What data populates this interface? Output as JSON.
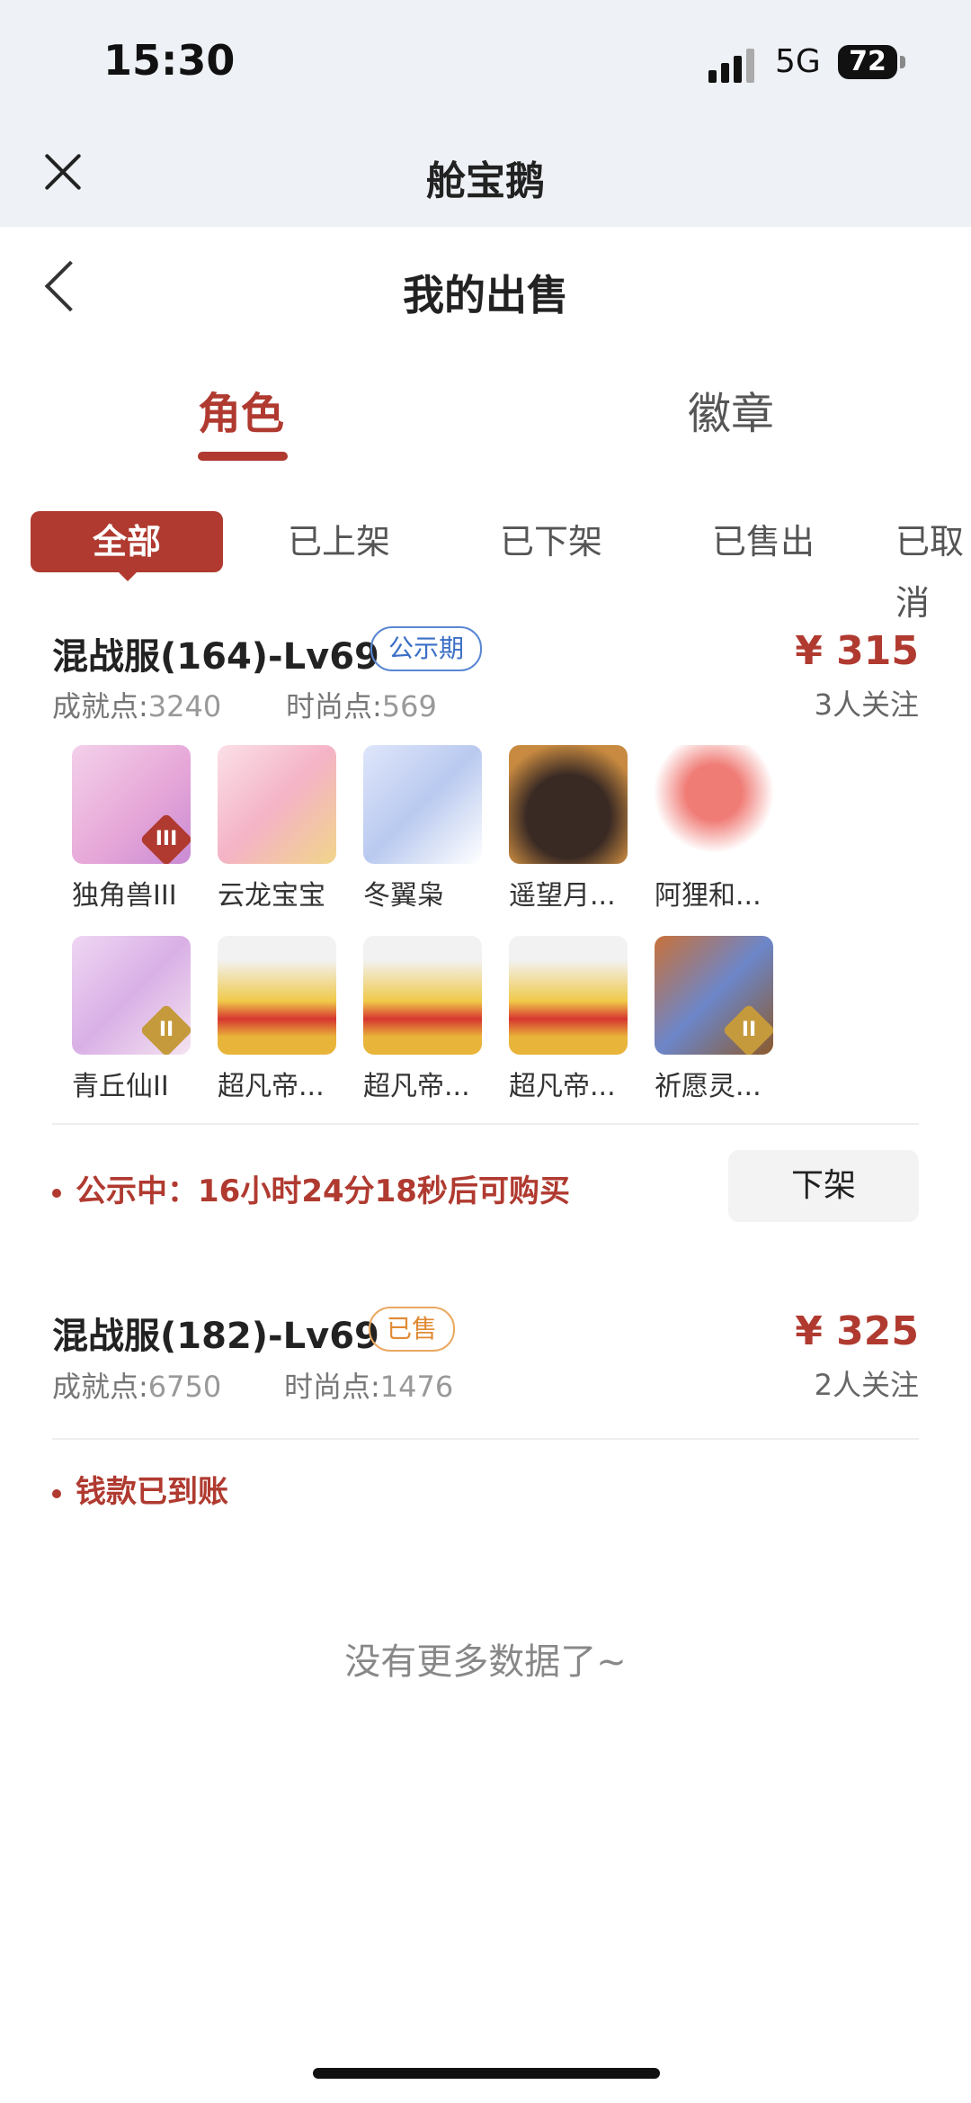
{
  "status_bar": {
    "time": "15:30",
    "network": "5G",
    "battery": "72"
  },
  "app": {
    "title": "舱宝鹅"
  },
  "page": {
    "title": "我的出售"
  },
  "tabs": [
    {
      "label": "角色",
      "active": true
    },
    {
      "label": "徽章",
      "active": false
    }
  ],
  "filters": [
    {
      "label": "全部",
      "active": true
    },
    {
      "label": "已上架",
      "active": false
    },
    {
      "label": "已下架",
      "active": false
    },
    {
      "label": "已售出",
      "active": false
    },
    {
      "label": "已取消",
      "active": false
    }
  ],
  "listings": [
    {
      "title": "混战服(164)-Lv69",
      "tag": "公示期",
      "price": "¥ 315",
      "achievement_label": "成就点:",
      "achievement": "3240",
      "fashion_label": "时尚点:",
      "fashion": "569",
      "followers": "3人关注",
      "items": [
        {
          "label": "独角兽III",
          "icon": "unicorn-icon",
          "badge": "III"
        },
        {
          "label": "云龙宝宝",
          "icon": "cloud-dragon-icon"
        },
        {
          "label": "冬翼枭",
          "icon": "winter-owl-icon"
        },
        {
          "label": "遥望月...",
          "icon": "moon-pig-icon"
        },
        {
          "label": "阿狸和...",
          "icon": "ali-fox-icon"
        },
        {
          "label": "青丘仙II",
          "icon": "fox-fairy-icon",
          "badge": "II"
        },
        {
          "label": "超凡帝...",
          "icon": "golden-armor-icon"
        },
        {
          "label": "超凡帝...",
          "icon": "golden-armor-icon"
        },
        {
          "label": "超凡帝...",
          "icon": "golden-armor-icon"
        },
        {
          "label": "祈愿灵...",
          "icon": "wish-bird-icon",
          "badge": "II"
        }
      ],
      "notice": "公示中：16小时24分18秒后可购买",
      "action": "下架"
    },
    {
      "title": "混战服(182)-Lv69",
      "tag": "已售",
      "price": "¥ 325",
      "achievement_label": "成就点:",
      "achievement": "6750",
      "fashion_label": "时尚点:",
      "fashion": "1476",
      "followers": "2人关注",
      "notice": "钱款已到账"
    }
  ],
  "footer": {
    "no_more": "没有更多数据了~"
  },
  "colors": {
    "accent": "#b03a30",
    "tag_blue": "#3b6fc5",
    "tag_orange": "#e08a34"
  }
}
